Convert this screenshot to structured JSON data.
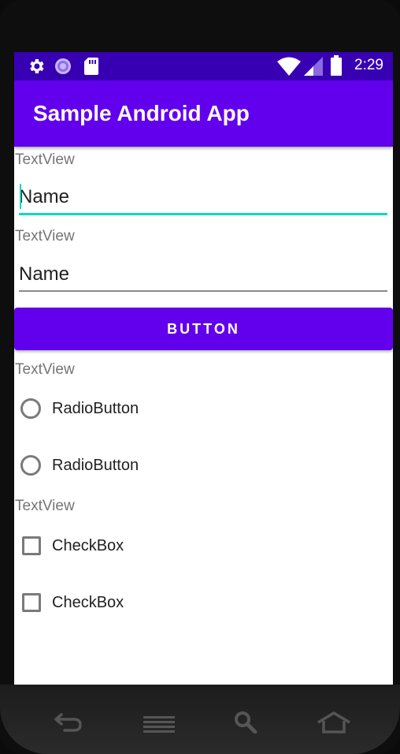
{
  "status_bar": {
    "time": "2:29",
    "left_icons": [
      "settings-icon",
      "sync-icon",
      "sd-card-icon"
    ],
    "right_icons": [
      "wifi-icon",
      "cell-signal-icon",
      "battery-icon"
    ],
    "background": "#3700b3"
  },
  "app_bar": {
    "title": "Sample Android App",
    "background": "#6200ee"
  },
  "form": {
    "text_view_1": "TextView",
    "edit_text_1": "Name",
    "text_view_2": "TextView",
    "edit_text_2": "Name",
    "button_label": "BUTTON",
    "text_view_3": "TextView",
    "radio_1": "RadioButton",
    "radio_2": "RadioButton",
    "text_view_4": "TextView",
    "checkbox_1": "CheckBox",
    "checkbox_2": "CheckBox"
  },
  "accent": {
    "primary": "#6200ee",
    "focus": "#03dac5"
  },
  "nav_bar": {
    "icons": [
      "back-icon",
      "menu-icon",
      "search-icon",
      "home-icon"
    ]
  }
}
